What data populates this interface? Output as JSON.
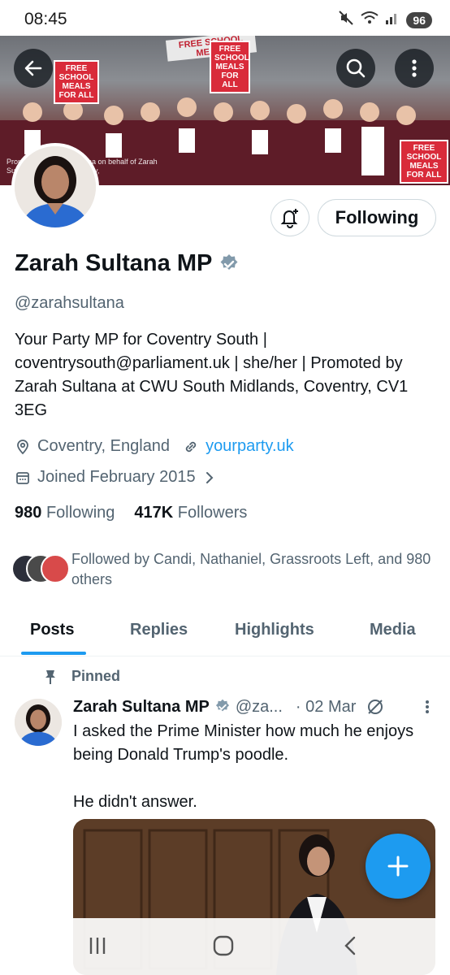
{
  "status_bar": {
    "time": "08:45",
    "battery": "96"
  },
  "banner": {
    "credit": "Promoted by Zarah Sultana on behalf of Zarah Sultana, Midlands, Coventry,",
    "signs": [
      "FREE SCHOOL MEALS FOR ALL",
      "FREE SCHOOL MEALS FOR ALL",
      "FREE SCHOOL MEALS FOR ALL"
    ],
    "top_banner": "FREE SCHOOL MEALS"
  },
  "profile": {
    "display_name": "Zarah Sultana MP",
    "handle": "@zarahsultana",
    "bio": "Your Party MP for Coventry South | coventrysouth@parliament.uk | she/her | Promoted by Zarah Sultana at CWU South Midlands, Coventry, CV1 3EG",
    "location": "Coventry, England",
    "website": "yourparty.uk",
    "joined": "Joined February 2015",
    "following_count": "980",
    "following_label": "Following",
    "followers_count": "417K",
    "followers_label": "Followers",
    "followed_by": "Followed by Candi, Nathaniel, Grassroots Left, and 980 others",
    "follow_button": "Following"
  },
  "tabs": [
    {
      "label": "Posts",
      "active": true
    },
    {
      "label": "Replies",
      "active": false
    },
    {
      "label": "Highlights",
      "active": false
    },
    {
      "label": "Media",
      "active": false
    }
  ],
  "pinned_tweet": {
    "pinned_label": "Pinned",
    "name": "Zarah Sultana MP",
    "handle": "@za...",
    "date": "· 02 Mar",
    "text": "I asked the Prime Minister how much he enjoys being Donald Trump's poodle.\n\nHe didn't answer."
  },
  "colors": {
    "accent": "#1d9bf0",
    "text": "#0f1419",
    "muted": "#536471"
  }
}
